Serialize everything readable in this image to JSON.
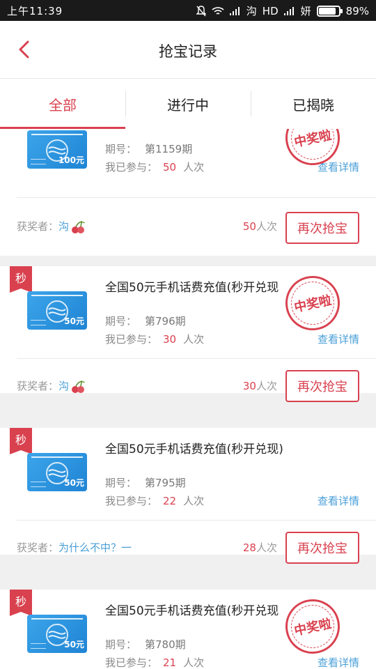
{
  "status": {
    "time": "上午11:39",
    "net": "HD",
    "extra": "沟",
    "carrier": "妍",
    "battery": "89%"
  },
  "header": {
    "title": "抢宝记录"
  },
  "tabs": [
    {
      "label": "全部"
    },
    {
      "label": "进行中"
    },
    {
      "label": "已揭晓"
    }
  ],
  "labels": {
    "period": "期号：",
    "joined": "我已参与：",
    "unit": "人次",
    "details": "查看详情",
    "winner": "获奖者：",
    "again": "再次抢宝",
    "flag": "秒",
    "stamp": "中奖啦"
  },
  "records": [
    {
      "product": "",
      "card_amount": "100元",
      "period": "第1159期",
      "joined": "50",
      "winner": "沟",
      "total": "50"
    },
    {
      "product": "全国50元手机话费充值(秒开兑现",
      "card_amount": "50元",
      "period": "第796期",
      "joined": "30",
      "winner": "沟",
      "total": "30"
    },
    {
      "product": "全国50元手机话费充值(秒开兑现)",
      "card_amount": "50元",
      "period": "第795期",
      "joined": "22",
      "winner": "为什么不中？一",
      "total": "28"
    },
    {
      "product": "全国50元手机话费充值(秒开兑现",
      "card_amount": "50元",
      "period": "第780期",
      "joined": "21",
      "winner": "",
      "total": ""
    }
  ],
  "colors": {
    "accent": "#d9414f",
    "link": "#4a9fd8"
  }
}
